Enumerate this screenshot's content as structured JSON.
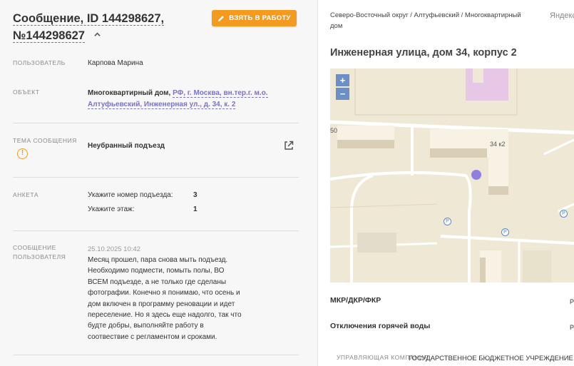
{
  "message": {
    "title": "Сообщение, ID 144298627, №144298627",
    "take_button": "ВЗЯТЬ В РАБОТУ",
    "user_label": "ПОЛЬЗОВАТЕЛЬ",
    "user_value": "Карпова Марина",
    "object_label": "ОБЪЕКТ",
    "object_type": "Многоквартирный дом,",
    "object_link": "РФ, г. Москва, вн.тер.г. м.о. Алтуфьевский, Инженерная ул., д. 34, к. 2",
    "topic_label": "ТЕМА СООБЩЕНИЯ",
    "topic_value": "Неубранный подъезд",
    "survey_label": "АНКЕТА",
    "survey": [
      {
        "q": "Укажите номер подъезда:",
        "a": "3"
      },
      {
        "q": "Укажите этаж:",
        "a": "1"
      }
    ],
    "user_message_label": "СООБЩЕНИЕ ПОЛЬЗОВАТЕЛЯ",
    "date": "25.10.2025 10:42",
    "text": "Месяц прошел, пара снова мыть подъезд. Необходимо подмести, помыть полы, ВО ВСЕМ подъезде, а не только где сделаны фотографии. Конечно я понимаю, что осень и дом включен в программу реновации и идет переселение. Но я здесь еще надолго, так что будте добры, выполняйте работу в соотвествие с регламентом и сроками."
  },
  "object_panel": {
    "breadcrumb": "Северо-Восточный округ / Алтуфьевский / Многоквартирный дом",
    "map_provider": "Яндекс",
    "address": "Инженерная улица, дом 34, корпус 2",
    "map_labels": {
      "house": "34 к2",
      "num50": "50",
      "parking": "P"
    },
    "zoom_in": "+",
    "zoom_out": "−",
    "rows": [
      {
        "label": "МКР/ДКР/ФКР",
        "value": "Р"
      },
      {
        "label": "Отключения горячей воды",
        "value": "Р"
      }
    ],
    "uk_label": "УПРАВЛЯЮЩАЯ КОМПАНИЯ",
    "uk_value": "ГОСУДАРСТВЕННОЕ БЮДЖЕТНОЕ УЧРЕЖДЕНИЕ"
  },
  "colors": {
    "accent": "#f39a1f",
    "link": "#7a72c4",
    "marker": "#8e7fe0",
    "map_bg": "#efe8d4"
  }
}
